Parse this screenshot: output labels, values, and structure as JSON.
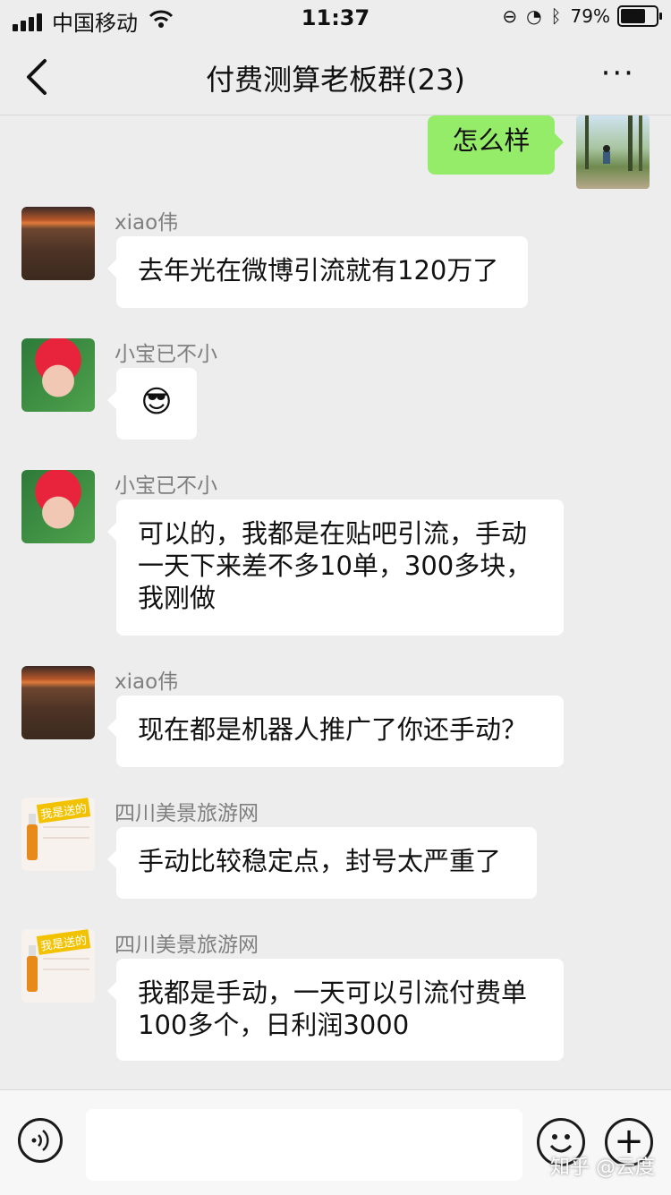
{
  "status_bar": {
    "carrier": "中国移动",
    "time": "11:37",
    "battery_percent": "79%",
    "battery_level": 0.79
  },
  "nav": {
    "back_icon": "chevron-left-icon",
    "title": "付费测算老板群(23)",
    "more_label": "···"
  },
  "messages": [
    {
      "self": true,
      "text": "怎么样"
    },
    {
      "sender": "xiao伟",
      "text": "去年光在微博引流就有120万了"
    },
    {
      "sender": "小宝已不小",
      "text": "😎"
    },
    {
      "sender": "小宝已不小",
      "text": "可以的，我都是在贴吧引流，手动一天下来差不多10单，300多块，我刚做"
    },
    {
      "sender": "xiao伟",
      "text": "现在都是机器人推广了你还手动？"
    },
    {
      "sender": "四川美景旅游网",
      "text": "手动比较稳定点，封号太严重了"
    },
    {
      "sender": "四川美景旅游网",
      "text": "我都是手动，一天可以引流付费单100多个，日利润3000"
    }
  ],
  "input_bar": {
    "placeholder": "",
    "voice_icon": "voice-icon",
    "emoji_icon": "emoji-icon",
    "plus_label": "+",
    "watermark": "知乎 @云度"
  },
  "avatar_badge": "我是送的",
  "colors": {
    "self_bubble": "#95ec69",
    "other_bubble": "#ffffff",
    "background": "#ededed"
  }
}
